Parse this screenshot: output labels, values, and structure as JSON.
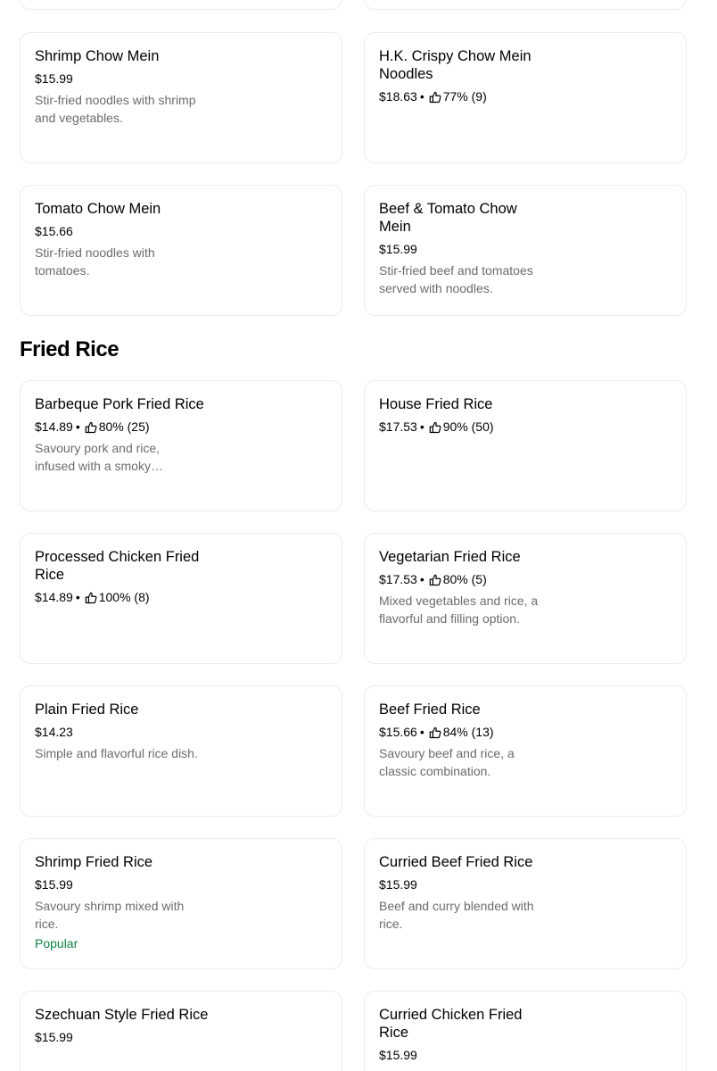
{
  "section": {
    "title": "Fried Rice"
  },
  "chow_mein": [
    {
      "name": "Shrimp Chow Mein",
      "price": "$15.99",
      "desc": "Stir-fried noodles with shrimp and vegetables."
    },
    {
      "name": "H.K. Crispy Chow Mein Noodles",
      "price": "$18.63",
      "sep": "•",
      "rating": "77% (9)"
    },
    {
      "name": "Tomato Chow Mein",
      "price": "$15.66",
      "desc": "Stir-fried noodles with tomatoes."
    },
    {
      "name": "Beef & Tomato Chow Mein",
      "price": "$15.99",
      "desc": "Stir-fried beef and tomatoes served with noodles."
    }
  ],
  "fried_rice": [
    {
      "name": "Barbeque Pork Fried Rice",
      "price": "$14.89",
      "sep": "•",
      "rating": "80% (25)",
      "desc": "Savoury pork and rice, infused with a smoky…"
    },
    {
      "name": "House Fried Rice",
      "price": "$17.53",
      "sep": "•",
      "rating": "90% (50)"
    },
    {
      "name": "Processed Chicken Fried Rice",
      "price": "$14.89",
      "sep": "•",
      "rating": "100% (8)"
    },
    {
      "name": "Vegetarian Fried Rice",
      "price": "$17.53",
      "sep": "•",
      "rating": "80% (5)",
      "desc": "Mixed vegetables and rice, a flavorful and filling option."
    },
    {
      "name": "Plain Fried Rice",
      "price": "$14.23",
      "desc": "Simple and flavorful rice dish."
    },
    {
      "name": "Beef Fried Rice",
      "price": "$15.66",
      "sep": "•",
      "rating": "84% (13)",
      "desc": "Savoury beef and rice, a classic combination."
    },
    {
      "name": "Shrimp Fried Rice",
      "price": "$15.99",
      "desc": "Savoury shrimp mixed with rice.",
      "badge": "Popular"
    },
    {
      "name": "Curried Beef Fried Rice",
      "price": "$15.99",
      "desc": "Beef and curry blended with rice."
    },
    {
      "name": "Szechuan Style Fried Rice",
      "price": "$15.99"
    },
    {
      "name": "Curried Chicken Fried Rice",
      "price": "$15.99"
    }
  ],
  "icons": {
    "rating": "thumbs-up-icon"
  },
  "colors": {
    "popular": "#0e8345",
    "description": "#6b6b6b",
    "border": "#ececec"
  }
}
